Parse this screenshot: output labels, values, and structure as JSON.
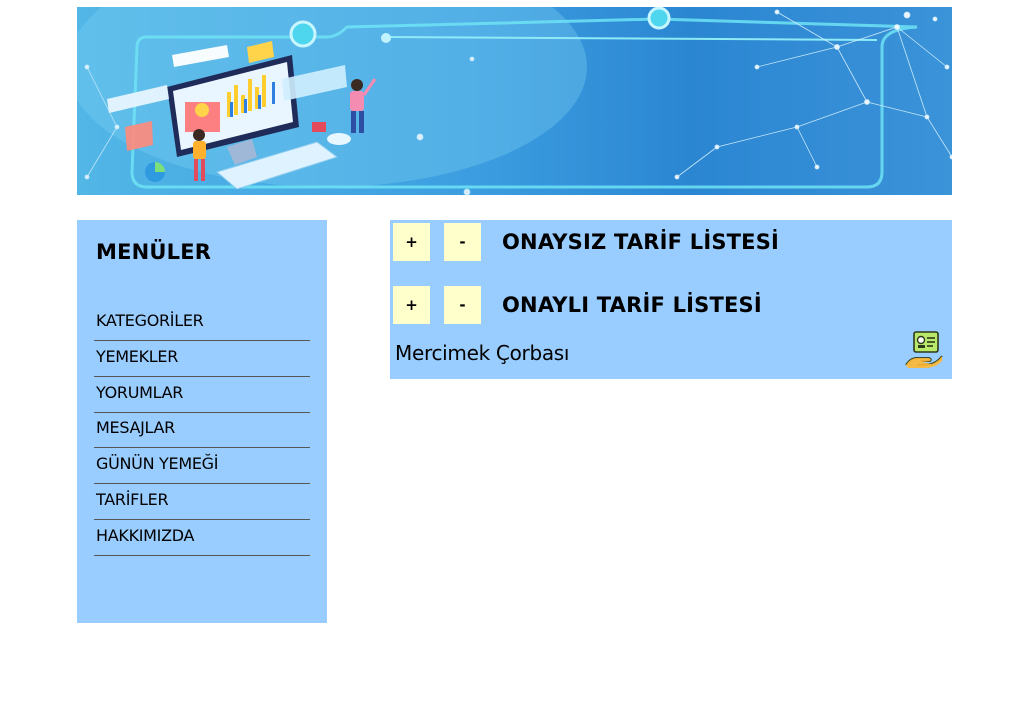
{
  "banner": {
    "image": "data-technology-illustration"
  },
  "sidebar": {
    "title": "MENÜLER",
    "items": [
      {
        "label": "KATEGORİLER"
      },
      {
        "label": "YEMEKLER"
      },
      {
        "label": "YORUMLAR"
      },
      {
        "label": "MESAJLAR"
      },
      {
        "label": "GÜNÜN YEMEĞİ"
      },
      {
        "label": "TARİFLER"
      },
      {
        "label": "HAKKIMIZDA"
      }
    ]
  },
  "main": {
    "unapproved": {
      "title": "ONAYSIZ TARİF LİSTESİ",
      "expand_label": "+",
      "collapse_label": "-"
    },
    "approved": {
      "title": "ONAYLI TARİF LİSTESİ",
      "expand_label": "+",
      "collapse_label": "-",
      "recipes": [
        {
          "name": "Mercimek Çorbası",
          "icon": "approve-hand-icon"
        }
      ]
    }
  },
  "colors": {
    "panel_bg": "#99ccff",
    "button_bg": "#ffffcc"
  }
}
